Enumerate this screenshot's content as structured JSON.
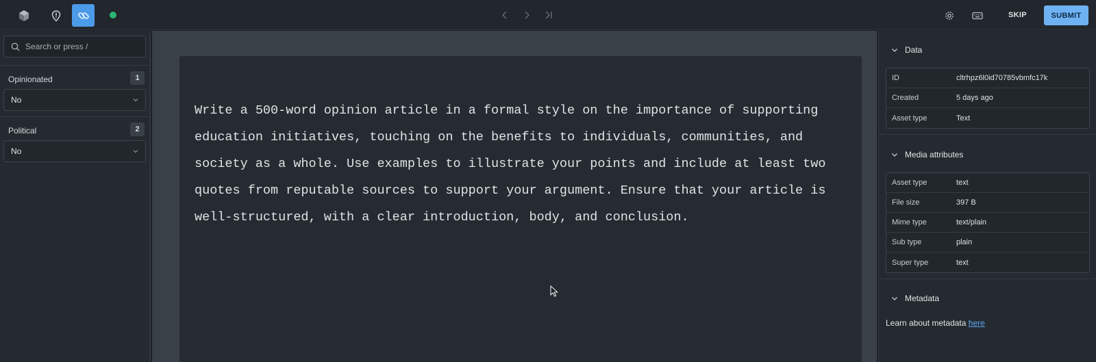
{
  "colors": {
    "accent": "#4c9be8",
    "submit": "#6fb2f3",
    "status": "#2bb673",
    "link": "#5aa9f0"
  },
  "topbar": {
    "icons": [
      "cube-icon",
      "pin-alert-icon",
      "link-icon",
      "status-dot",
      "chevron-left-icon",
      "chevron-right-icon",
      "skip-to-end-icon",
      "gear-icon",
      "keyboard-icon"
    ],
    "skip_label": "SKIP",
    "submit_label": "SUBMIT"
  },
  "sidebar": {
    "search_placeholder": "Search or press /",
    "fields": [
      {
        "label": "Opinionated",
        "badge": "1",
        "value": "No"
      },
      {
        "label": "Political",
        "badge": "2",
        "value": "No"
      }
    ]
  },
  "main": {
    "prompt_text": "Write a 500-word opinion article in a formal style on the importance of supporting education initiatives, touching on the benefits to individuals, communities, and society as a whole. Use examples to illustrate your points and include at least two quotes from reputable sources to support your argument. Ensure that your article is well-structured, with a clear introduction, body, and conclusion."
  },
  "right": {
    "data_section": {
      "title": "Data",
      "rows": [
        {
          "key": "ID",
          "value": "cltrhpz6l0id70785vbmfc17k"
        },
        {
          "key": "Created",
          "value": "5 days ago"
        },
        {
          "key": "Asset type",
          "value": "Text"
        }
      ]
    },
    "media_section": {
      "title": "Media attributes",
      "rows": [
        {
          "key": "Asset type",
          "value": "text"
        },
        {
          "key": "File size",
          "value": "397 B"
        },
        {
          "key": "Mime type",
          "value": "text/plain"
        },
        {
          "key": "Sub type",
          "value": "plain"
        },
        {
          "key": "Super type",
          "value": "text"
        }
      ]
    },
    "metadata_section": {
      "title": "Metadata",
      "text": "Learn about metadata",
      "link": "here"
    }
  }
}
